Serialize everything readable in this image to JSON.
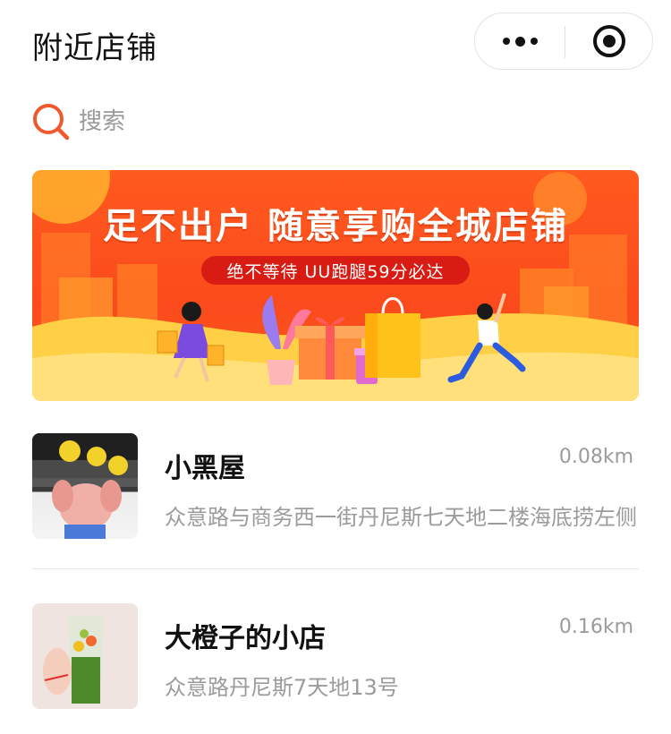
{
  "header": {
    "title": "附近店铺",
    "more_icon": "more-dots-icon",
    "close_icon": "target-circle-icon"
  },
  "search": {
    "placeholder": "搜索",
    "icon": "search-icon"
  },
  "banner": {
    "headline": "足不出户 随意享购全城店铺",
    "tagline": "绝不等待 UU跑腿59分必达"
  },
  "stores": [
    {
      "name": "小黑屋",
      "distance": "0.08km",
      "address": "众意路与商务西一街丹尼斯七天地二楼海底捞左侧"
    },
    {
      "name": "大橙子的小店",
      "distance": "0.16km",
      "address": "众意路丹尼斯7天地13号"
    }
  ],
  "colors": {
    "accent": "#ff5a1f",
    "text_primary": "#111111",
    "text_secondary": "#9b9b9b"
  }
}
